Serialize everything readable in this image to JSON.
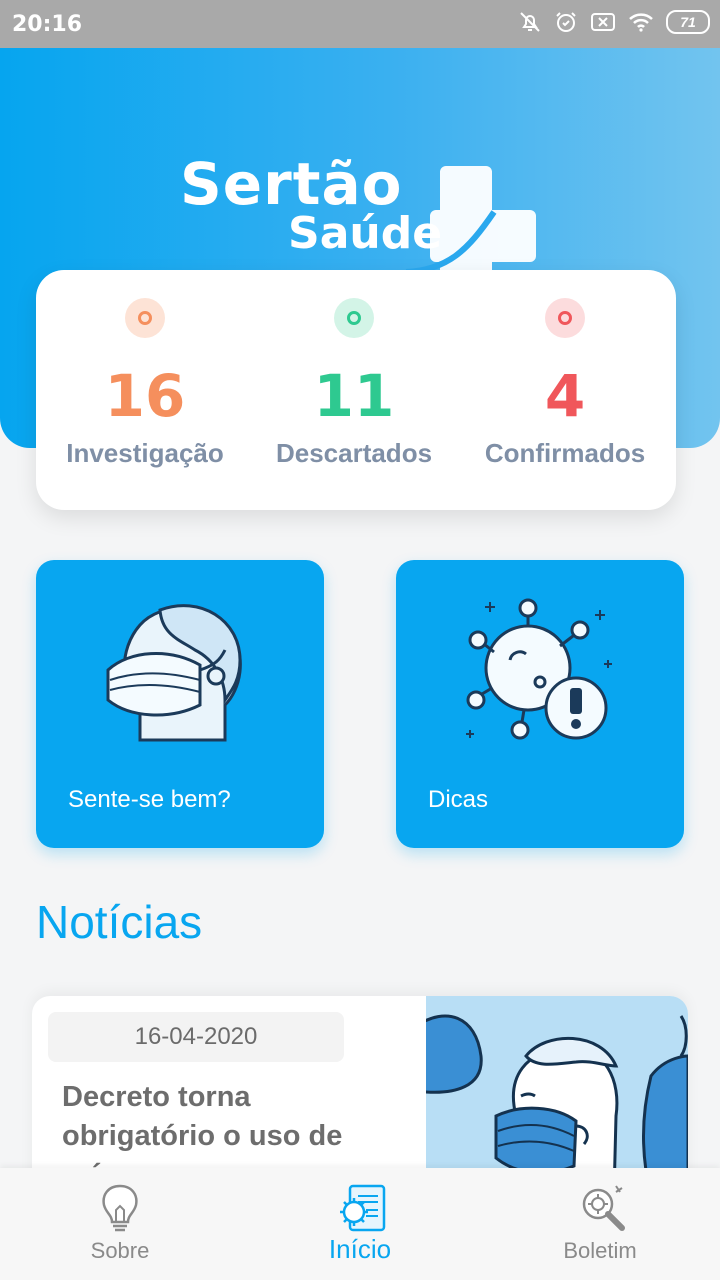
{
  "status_bar": {
    "time": "20:16",
    "battery": "71"
  },
  "brand": {
    "line1": "Sertão",
    "line2": "Saúde"
  },
  "stats": [
    {
      "value": "16",
      "label": "Investigação",
      "color": "#f58f5d",
      "dot_bg": "#fde3d6"
    },
    {
      "value": "11",
      "label": "Descartados",
      "color": "#2ec990",
      "dot_bg": "#d3f4e7"
    },
    {
      "value": "4",
      "label": "Confirmados",
      "color": "#f0575b",
      "dot_bg": "#fcdcdd"
    }
  ],
  "tiles": [
    {
      "label": "Sente-se bem?",
      "icon": "face-mask-icon"
    },
    {
      "label": "Dicas",
      "icon": "virus-alert-icon"
    }
  ],
  "news": {
    "title": "Notícias",
    "items": [
      {
        "date": "16-04-2020",
        "headline": "Decreto torna obrigatório o uso de máscaras nos"
      }
    ]
  },
  "bottom_nav": [
    {
      "label": "Sobre",
      "icon": "lightbulb-icon",
      "active": false
    },
    {
      "label": "Início",
      "icon": "home-virus-icon",
      "active": true
    },
    {
      "label": "Boletim",
      "icon": "magnifier-icon",
      "active": false
    }
  ],
  "colors": {
    "primary": "#08a6f0",
    "background": "#f4f5f6"
  }
}
